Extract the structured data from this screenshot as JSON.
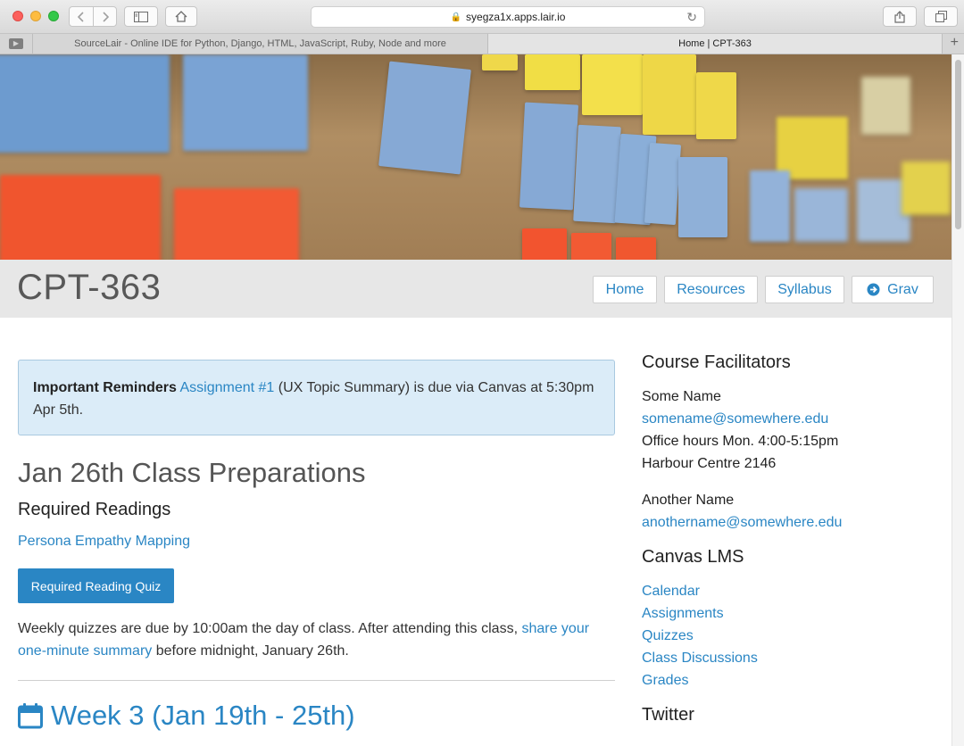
{
  "browser": {
    "url": "syegza1x.apps.lair.io",
    "tabs": [
      {
        "label": "SourceLair - Online IDE for Python, Django, HTML, JavaScript, Ruby, Node and more"
      },
      {
        "label": "Home | CPT-363"
      }
    ],
    "new_tab_label": "+"
  },
  "header": {
    "title": "CPT-363",
    "nav": [
      {
        "label": "Home"
      },
      {
        "label": "Resources"
      },
      {
        "label": "Syllabus"
      },
      {
        "label": "Grav"
      }
    ]
  },
  "main": {
    "alert": {
      "bold": "Important Reminders",
      "link": "Assignment #1",
      "text": " (UX Topic Summary) is due via Canvas at 5:30pm Apr 5th."
    },
    "section_title": "Jan 26th Class Preparations",
    "readings_heading": "Required Readings",
    "reading_link": "Persona Empathy Mapping",
    "quiz_button": "Required Reading Quiz",
    "paragraph": {
      "before": "Weekly quizzes are due by 10:00am the day of class. After attending this class, ",
      "link": "share your one-minute summary",
      "after": " before midnight, January 26th."
    },
    "week_title": "Week 3 (Jan 19th - 25th)"
  },
  "sidebar": {
    "facilitators_heading": "Course Facilitators",
    "facilitator1": {
      "name": "Some Name",
      "email": "somename@somewhere.edu",
      "hours": "Office hours Mon. 4:00-5:15pm",
      "location": "Harbour Centre 2146"
    },
    "facilitator2": {
      "name": "Another Name",
      "email": "anothername@somewhere.edu"
    },
    "lms_heading": "Canvas LMS",
    "lms_links": [
      {
        "label": "Calendar"
      },
      {
        "label": "Assignments"
      },
      {
        "label": "Quizzes"
      },
      {
        "label": "Class Discussions"
      },
      {
        "label": "Grades"
      }
    ],
    "twitter_heading": "Twitter"
  },
  "colors": {
    "link": "#2a86c4",
    "header_bg": "#e7e7e7",
    "alert_bg": "#dbecf8"
  }
}
